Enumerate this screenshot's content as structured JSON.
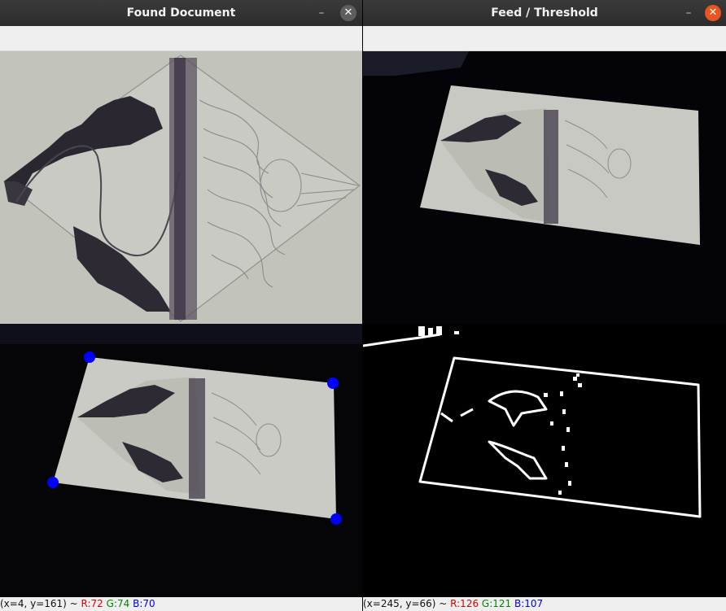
{
  "windows": [
    {
      "title": "Found Document",
      "status": {
        "coords": "(x=4, y=161) ~ ",
        "r": "R:72",
        "g": "G:74",
        "b": "B:70"
      }
    },
    {
      "title": "Feed / Threshold",
      "status": {
        "coords": "(x=245, y=66) ~ ",
        "r": "R:126",
        "g": "G:121",
        "b": "B:107"
      }
    }
  ],
  "icons": {
    "minimize": "minimize-icon",
    "close": "close-icon"
  },
  "colors": {
    "titlebar": "#2c2c2c",
    "close_active": "#e95420",
    "close_inactive": "#5e5e5e",
    "corner_marker": "#0000ff",
    "paper": "#c6c8c1",
    "background": "#000000"
  }
}
